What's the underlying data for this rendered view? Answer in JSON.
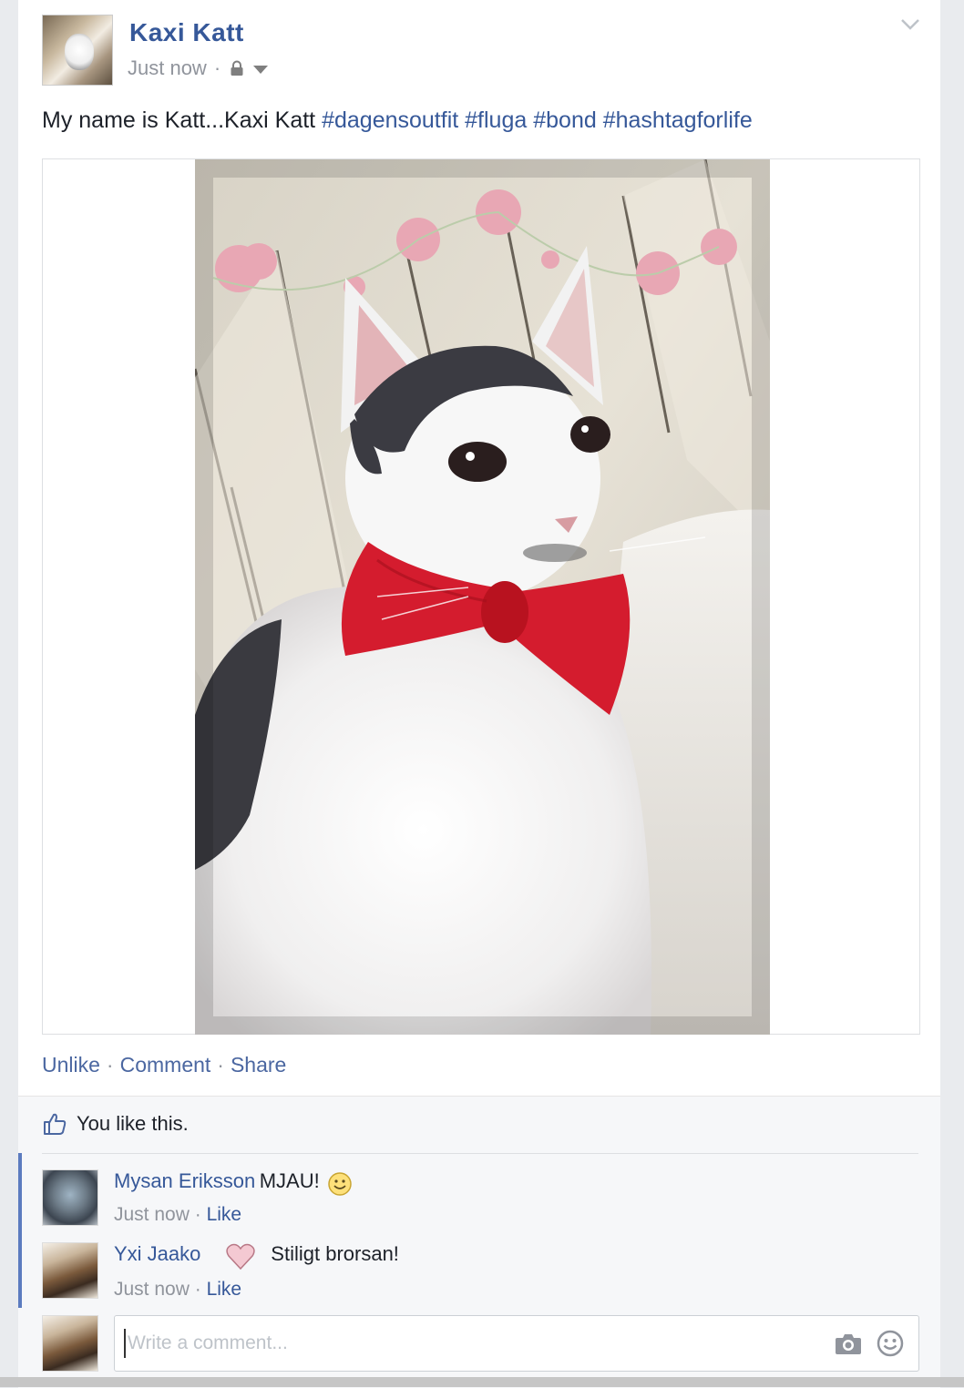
{
  "post": {
    "author": "Kaxi Katt",
    "timestamp": "Just now",
    "separator": "·",
    "audience_icon": "lock-icon",
    "text_plain": "My name is Katt...Kaxi Katt",
    "hashtags": [
      "#dagensoutfit",
      "#fluga",
      "#bond",
      "#hashtagforlife"
    ]
  },
  "actions": {
    "unlike": "Unlike",
    "comment": "Comment",
    "share": "Share",
    "separator": "·"
  },
  "likes": {
    "text": "You like this.",
    "icon": "thumbs-up-icon"
  },
  "comments": [
    {
      "name": "Mysan Eriksson",
      "text": "MJAU!",
      "emoji": "smiley-icon",
      "time": "Just now",
      "like_label": "Like"
    },
    {
      "name": "Yxi Jaako",
      "text": "Stiligt brorsan!",
      "emoji": "heart-icon",
      "time": "Just now",
      "like_label": "Like"
    }
  ],
  "composer": {
    "placeholder": "Write a comment...",
    "camera_icon": "camera-icon",
    "emoji_icon": "emoji-icon"
  },
  "colors": {
    "link": "#365899",
    "muted": "#90949c",
    "bow": "#d41c2e",
    "thread_bar": "#5b7bbf"
  }
}
